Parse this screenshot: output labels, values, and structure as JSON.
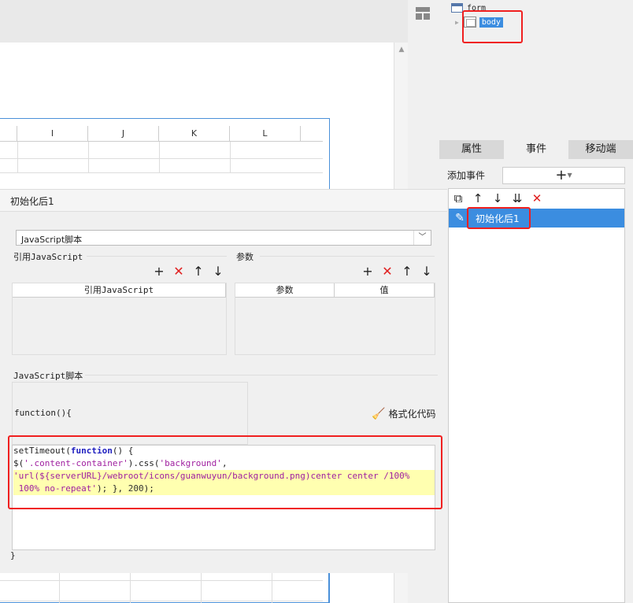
{
  "tree": {
    "form_label": "form",
    "body_label": "body"
  },
  "tabs": [
    {
      "label": "属性"
    },
    {
      "label": "事件"
    },
    {
      "label": "移动端"
    }
  ],
  "add_event": {
    "label": "添加事件",
    "button": "+"
  },
  "event_list": {
    "items": [
      {
        "label": "初始化后1"
      }
    ]
  },
  "sheet": {
    "columns": [
      "I",
      "J",
      "K",
      "L"
    ]
  },
  "dialog": {
    "title": "初始化后1",
    "script_type": "JavaScript脚本",
    "ref_js_label": "引用JavaScript",
    "params_label": "参数",
    "ref_table_header": "引用JavaScript",
    "params_table_headers": [
      "参数",
      "值"
    ],
    "script_section_label": "JavaScript脚本",
    "fn_open": "function(){",
    "fn_close": "}",
    "format_label": "格式化代码",
    "code_lines": [
      "setTimeout(function() {",
      "$('.content-container').css('background',",
      "'url(${serverURL}/webroot/icons/guanwuyun/background.png)center center /100%",
      " 100% no-repeat'); }, 200);"
    ]
  },
  "colors": {
    "accent": "#3b8de0",
    "highlight_box": "#f02020",
    "delete_icon": "#e02020"
  }
}
